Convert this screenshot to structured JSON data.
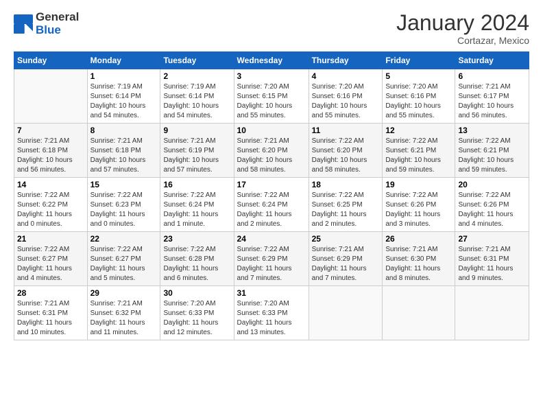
{
  "logo": {
    "line1": "General",
    "line2": "Blue"
  },
  "title": "January 2024",
  "subtitle": "Cortazar, Mexico",
  "days_of_week": [
    "Sunday",
    "Monday",
    "Tuesday",
    "Wednesday",
    "Thursday",
    "Friday",
    "Saturday"
  ],
  "weeks": [
    [
      {
        "day": "",
        "info": ""
      },
      {
        "day": "1",
        "info": "Sunrise: 7:19 AM\nSunset: 6:14 PM\nDaylight: 10 hours\nand 54 minutes."
      },
      {
        "day": "2",
        "info": "Sunrise: 7:19 AM\nSunset: 6:14 PM\nDaylight: 10 hours\nand 54 minutes."
      },
      {
        "day": "3",
        "info": "Sunrise: 7:20 AM\nSunset: 6:15 PM\nDaylight: 10 hours\nand 55 minutes."
      },
      {
        "day": "4",
        "info": "Sunrise: 7:20 AM\nSunset: 6:16 PM\nDaylight: 10 hours\nand 55 minutes."
      },
      {
        "day": "5",
        "info": "Sunrise: 7:20 AM\nSunset: 6:16 PM\nDaylight: 10 hours\nand 55 minutes."
      },
      {
        "day": "6",
        "info": "Sunrise: 7:21 AM\nSunset: 6:17 PM\nDaylight: 10 hours\nand 56 minutes."
      }
    ],
    [
      {
        "day": "7",
        "info": "Sunrise: 7:21 AM\nSunset: 6:18 PM\nDaylight: 10 hours\nand 56 minutes."
      },
      {
        "day": "8",
        "info": "Sunrise: 7:21 AM\nSunset: 6:18 PM\nDaylight: 10 hours\nand 57 minutes."
      },
      {
        "day": "9",
        "info": "Sunrise: 7:21 AM\nSunset: 6:19 PM\nDaylight: 10 hours\nand 57 minutes."
      },
      {
        "day": "10",
        "info": "Sunrise: 7:21 AM\nSunset: 6:20 PM\nDaylight: 10 hours\nand 58 minutes."
      },
      {
        "day": "11",
        "info": "Sunrise: 7:22 AM\nSunset: 6:20 PM\nDaylight: 10 hours\nand 58 minutes."
      },
      {
        "day": "12",
        "info": "Sunrise: 7:22 AM\nSunset: 6:21 PM\nDaylight: 10 hours\nand 59 minutes."
      },
      {
        "day": "13",
        "info": "Sunrise: 7:22 AM\nSunset: 6:21 PM\nDaylight: 10 hours\nand 59 minutes."
      }
    ],
    [
      {
        "day": "14",
        "info": "Sunrise: 7:22 AM\nSunset: 6:22 PM\nDaylight: 11 hours\nand 0 minutes."
      },
      {
        "day": "15",
        "info": "Sunrise: 7:22 AM\nSunset: 6:23 PM\nDaylight: 11 hours\nand 0 minutes."
      },
      {
        "day": "16",
        "info": "Sunrise: 7:22 AM\nSunset: 6:24 PM\nDaylight: 11 hours\nand 1 minute."
      },
      {
        "day": "17",
        "info": "Sunrise: 7:22 AM\nSunset: 6:24 PM\nDaylight: 11 hours\nand 2 minutes."
      },
      {
        "day": "18",
        "info": "Sunrise: 7:22 AM\nSunset: 6:25 PM\nDaylight: 11 hours\nand 2 minutes."
      },
      {
        "day": "19",
        "info": "Sunrise: 7:22 AM\nSunset: 6:26 PM\nDaylight: 11 hours\nand 3 minutes."
      },
      {
        "day": "20",
        "info": "Sunrise: 7:22 AM\nSunset: 6:26 PM\nDaylight: 11 hours\nand 4 minutes."
      }
    ],
    [
      {
        "day": "21",
        "info": "Sunrise: 7:22 AM\nSunset: 6:27 PM\nDaylight: 11 hours\nand 4 minutes."
      },
      {
        "day": "22",
        "info": "Sunrise: 7:22 AM\nSunset: 6:27 PM\nDaylight: 11 hours\nand 5 minutes."
      },
      {
        "day": "23",
        "info": "Sunrise: 7:22 AM\nSunset: 6:28 PM\nDaylight: 11 hours\nand 6 minutes."
      },
      {
        "day": "24",
        "info": "Sunrise: 7:22 AM\nSunset: 6:29 PM\nDaylight: 11 hours\nand 7 minutes."
      },
      {
        "day": "25",
        "info": "Sunrise: 7:21 AM\nSunset: 6:29 PM\nDaylight: 11 hours\nand 7 minutes."
      },
      {
        "day": "26",
        "info": "Sunrise: 7:21 AM\nSunset: 6:30 PM\nDaylight: 11 hours\nand 8 minutes."
      },
      {
        "day": "27",
        "info": "Sunrise: 7:21 AM\nSunset: 6:31 PM\nDaylight: 11 hours\nand 9 minutes."
      }
    ],
    [
      {
        "day": "28",
        "info": "Sunrise: 7:21 AM\nSunset: 6:31 PM\nDaylight: 11 hours\nand 10 minutes."
      },
      {
        "day": "29",
        "info": "Sunrise: 7:21 AM\nSunset: 6:32 PM\nDaylight: 11 hours\nand 11 minutes."
      },
      {
        "day": "30",
        "info": "Sunrise: 7:20 AM\nSunset: 6:33 PM\nDaylight: 11 hours\nand 12 minutes."
      },
      {
        "day": "31",
        "info": "Sunrise: 7:20 AM\nSunset: 6:33 PM\nDaylight: 11 hours\nand 13 minutes."
      },
      {
        "day": "",
        "info": ""
      },
      {
        "day": "",
        "info": ""
      },
      {
        "day": "",
        "info": ""
      }
    ]
  ]
}
